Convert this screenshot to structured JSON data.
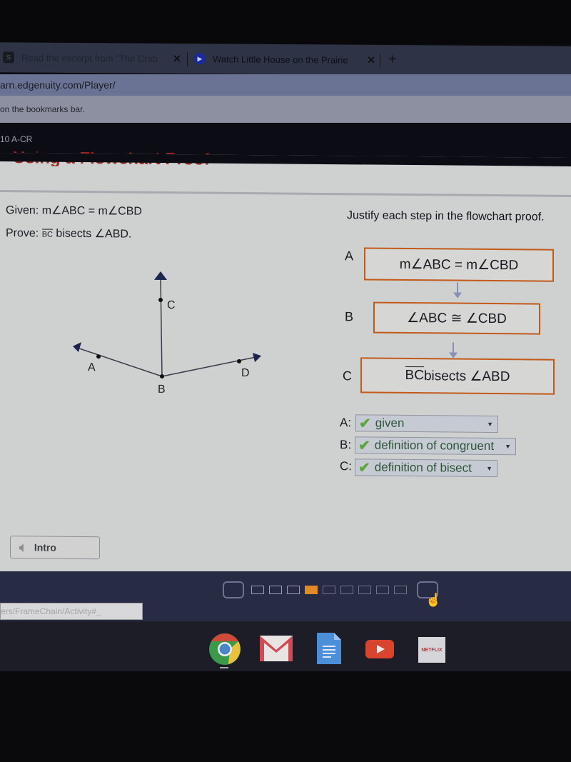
{
  "browser": {
    "tabs": [
      {
        "title": "Read the excerpt from \"The Crab",
        "icon": "edgenuity-favicon",
        "active": false
      },
      {
        "title": "Watch Little House on the Prairie",
        "icon": "play-favicon",
        "active": true
      }
    ],
    "new_tab_label": "+",
    "close_label": "✕",
    "address": "arn.edgenuity.com/Player/",
    "bookmarks_hint": "on the bookmarks bar.",
    "status_url": "ers/FrameChain/Activity#_"
  },
  "course": {
    "label": "10 A-CR",
    "lesson_title": "Using a Flowchart Proof"
  },
  "problem": {
    "given_label": "Given:",
    "given": "m∠ABC = m∠CBD",
    "prove_label": "Prove:",
    "prove_ray": "BC",
    "prove_rest": " bisects ∠ABD.",
    "diagram": {
      "points": [
        {
          "name": "A"
        },
        {
          "name": "B"
        },
        {
          "name": "C"
        },
        {
          "name": "D"
        }
      ],
      "rays": [
        "BA",
        "BC",
        "BD"
      ]
    }
  },
  "flowchart": {
    "instruction": "Justify each step in the flowchart proof.",
    "steps": [
      {
        "letter": "A",
        "statement": "m∠ABC = m∠CBD"
      },
      {
        "letter": "B",
        "statement": "∠ABC ≅ ∠CBD"
      },
      {
        "letter": "C",
        "ray": "BC",
        "statement": " bisects ∠ABD"
      }
    ],
    "answers": [
      {
        "label": "A:",
        "value": "given",
        "correct": true
      },
      {
        "label": "B:",
        "value": "definition of congruent",
        "correct": true
      },
      {
        "label": "C:",
        "value": "definition of bisect",
        "correct": true
      }
    ],
    "check_glyph": "✔",
    "caret_glyph": "▼"
  },
  "footer": {
    "intro_label": "Intro",
    "pages": {
      "total": 9,
      "current": 4
    },
    "accent_color": "#e08a2a"
  },
  "shelf": {
    "apps": [
      "Chrome",
      "Gmail",
      "Docs",
      "YouTube",
      "Netflix"
    ],
    "netflix_label": "NETFLIX"
  }
}
